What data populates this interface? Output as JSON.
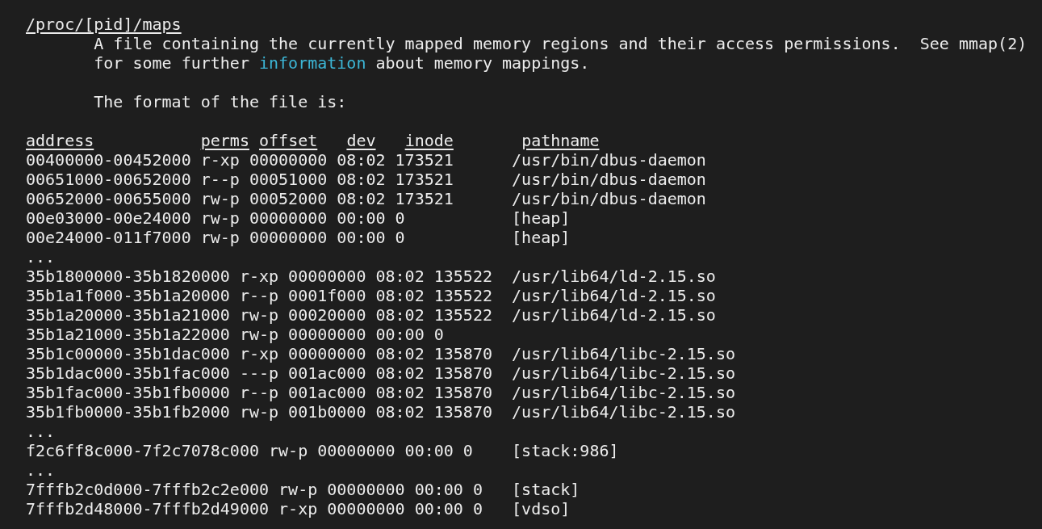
{
  "title": "/proc/[pid]/maps",
  "description": {
    "line_1": "A file containing the currently mapped memory regions and their access permissions.  See mmap(2)",
    "before_link": "for some further ",
    "link": "information",
    "after_link": " about memory mappings."
  },
  "format_intro": "The format of the file is:",
  "table_header": "address           perms offset   dev   inode       pathname",
  "lines": [
    "00400000-00452000 r-xp 00000000 08:02 173521      /usr/bin/dbus-daemon",
    "00651000-00652000 r--p 00051000 08:02 173521      /usr/bin/dbus-daemon",
    "00652000-00655000 rw-p 00052000 08:02 173521      /usr/bin/dbus-daemon",
    "00e03000-00e24000 rw-p 00000000 00:00 0           [heap]",
    "00e24000-011f7000 rw-p 00000000 00:00 0           [heap]",
    "...",
    "35b1800000-35b1820000 r-xp 00000000 08:02 135522  /usr/lib64/ld-2.15.so",
    "35b1a1f000-35b1a20000 r--p 0001f000 08:02 135522  /usr/lib64/ld-2.15.so",
    "35b1a20000-35b1a21000 rw-p 00020000 08:02 135522  /usr/lib64/ld-2.15.so",
    "35b1a21000-35b1a22000 rw-p 00000000 00:00 0",
    "35b1c00000-35b1dac000 r-xp 00000000 08:02 135870  /usr/lib64/libc-2.15.so",
    "35b1dac000-35b1fac000 ---p 001ac000 08:02 135870  /usr/lib64/libc-2.15.so",
    "35b1fac000-35b1fb0000 r--p 001ac000 08:02 135870  /usr/lib64/libc-2.15.so",
    "35b1fb0000-35b1fb2000 rw-p 001b0000 08:02 135870  /usr/lib64/libc-2.15.so",
    "...",
    "f2c6ff8c000-7f2c7078c000 rw-p 00000000 00:00 0    [stack:986]",
    "...",
    "7fffb2c0d000-7fffb2c2e000 rw-p 00000000 00:00 0   [stack]",
    "7fffb2d48000-7fffb2d49000 r-xp 00000000 00:00 0   [vdso]"
  ]
}
